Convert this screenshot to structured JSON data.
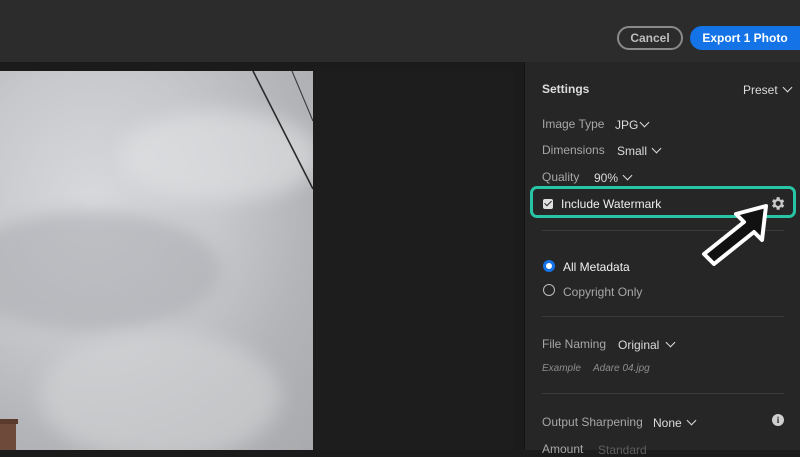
{
  "toolbar": {
    "cancel_label": "Cancel",
    "export_label": "Export 1 Photo"
  },
  "settings": {
    "title": "Settings",
    "preset_label": "Preset",
    "image_type": {
      "label": "Image Type",
      "value": "JPG"
    },
    "dimensions": {
      "label": "Dimensions",
      "value": "Small"
    },
    "quality": {
      "label": "Quality",
      "value": "90%"
    },
    "watermark": {
      "label": "Include Watermark",
      "checked": true
    }
  },
  "metadata": {
    "options": [
      {
        "label": "All Metadata",
        "selected": true
      },
      {
        "label": "Copyright Only",
        "selected": false
      }
    ]
  },
  "file_naming": {
    "label": "File Naming",
    "value": "Original",
    "example_label": "Example",
    "example_value": "Adare 04.jpg"
  },
  "output_sharpening": {
    "label": "Output Sharpening",
    "value": "None"
  },
  "amount": {
    "label": "Amount",
    "value": "Standard"
  },
  "colors": {
    "accent": "#1473e6",
    "highlight": "#27c4a5"
  }
}
